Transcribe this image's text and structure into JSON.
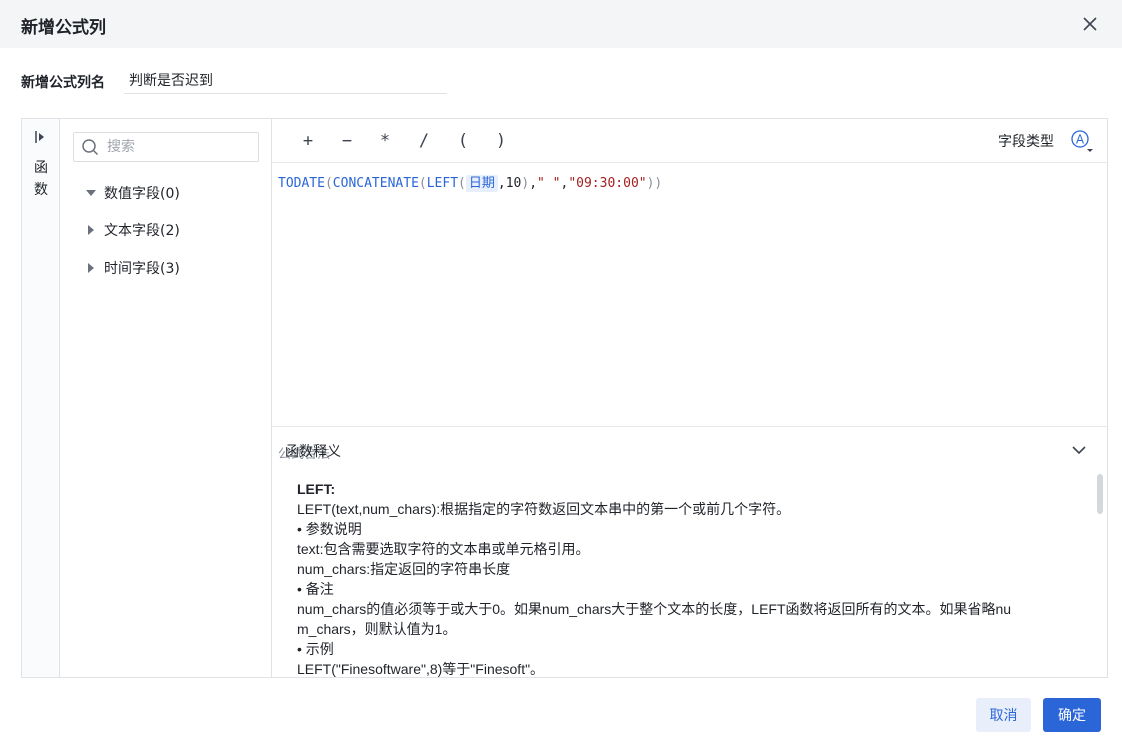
{
  "dialog": {
    "title": "新增公式列",
    "name_label": "新增公式列名",
    "name_value": "判断是否迟到"
  },
  "sidebar": {
    "func_label_1": "函",
    "func_label_2": "数"
  },
  "fields": {
    "search_placeholder": "搜索",
    "groups": [
      {
        "label": "数值字段(0)",
        "expanded": true
      },
      {
        "label": "文本字段(2)",
        "expanded": false
      },
      {
        "label": "时间字段(3)",
        "expanded": false
      }
    ]
  },
  "toolbar": {
    "ops": [
      "+",
      "−",
      "*",
      "/",
      "(",
      ")"
    ],
    "field_type_label": "字段类型",
    "field_type_icon": "circled-A-icon"
  },
  "formula": {
    "fn1": "TODATE",
    "fn2": "CONCATENATE",
    "fn3": "LEFT",
    "field": "日期",
    "num": "10",
    "str1": "\" \"",
    "str2": "\"09:30:00\"",
    "valid_text": "公式合法"
  },
  "description": {
    "title": "函数释义",
    "lines": [
      "LEFT:",
      "LEFT(text,num_chars):根据指定的字符数返回文本串中的第一个或前几个字符。",
      "•  参数说明",
      "text:包含需要选取字符的文本串或单元格引用。",
      "num_chars:指定返回的字符串长度",
      "•  备注",
      "num_chars的值必须等于或大于0。如果num_chars大于整个文本的长度，LEFT函数将返回所有的文本。如果省略nu",
      "m_chars，则默认值为1。",
      "•  示例",
      "LEFT(\"Finesoftware\",8)等于\"Finesoft\"。"
    ]
  },
  "footer": {
    "cancel_label": "取消",
    "ok_label": "确定"
  },
  "colors": {
    "primary": "#2b66d9",
    "string": "#a32121",
    "border": "#e0e2e6"
  }
}
